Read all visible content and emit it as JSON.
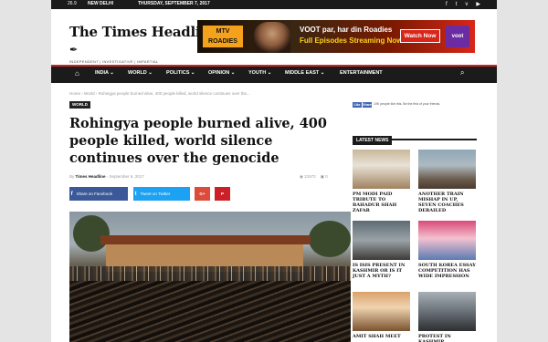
{
  "topbar": {
    "weather": "26.9",
    "city": "NEW DELHI",
    "date": "THURSDAY, SEPTEMBER 7, 2017",
    "social_icons": [
      "facebook-icon",
      "twitter-icon",
      "vimeo-icon",
      "youtube-icon"
    ]
  },
  "logo": {
    "name": "The Times Headline",
    "tagline": "INDEPENDENT | INVESTIGATIVE | IMPARTIAL"
  },
  "ad": {
    "brand": "MTV ROADIES",
    "line1": "VOOT par, har din Roadies",
    "line2": "Full Episodes Streaming Now",
    "button": "Watch Now",
    "logo": "voot"
  },
  "nav": {
    "items": [
      "INDIA",
      "WORLD",
      "POLITICS",
      "OPINION",
      "YOUTH",
      "MIDDLE EAST",
      "ENTERTAINMENT"
    ]
  },
  "breadcrumb": "Home  ›  World  ›  Rohingya people burned alive, 400 people killed, world silence continues over the...",
  "category": "WORLD",
  "article": {
    "title": "Rohingya people burned alive, 400 people killed, world silence continues over the genocide",
    "by": "By",
    "author": "Times Headline",
    "date": "September 6, 2017",
    "views": "21972",
    "comments": "0"
  },
  "share": {
    "facebook": "Share on Facebook",
    "twitter": "Tweet on Twitter",
    "googleplus": "G+",
    "pinterest": "P"
  },
  "sidebar": {
    "like": "Like",
    "share": "Share",
    "fb_text": "10K people like this. Be the first of your friends.",
    "latest": "LATEST NEWS",
    "cards": [
      {
        "caption": "PM MODI PAID TRIBUTE TO BAHADUR SHAH ZAFAR"
      },
      {
        "caption": "ANOTHER TRAIN MISHAP IN UP, SEVEN COACHES DERAILED"
      },
      {
        "caption": "IS ISIS PRESENT IN KASHMIR OR IS IT JUST A MYTH?"
      },
      {
        "caption": "SOUTH KOREA ESSAY COMPETITION HAS WIDE IMPRESSION"
      },
      {
        "caption": "AMIT SHAH MEET"
      },
      {
        "caption": "PROTEST IN KASHMIR"
      }
    ]
  },
  "colors": {
    "accent": "#c62828",
    "dark": "#1b1b1b",
    "facebook": "#3b5998",
    "twitter": "#1da1f2",
    "googleplus": "#dd4b39",
    "pinterest": "#cb2027"
  }
}
